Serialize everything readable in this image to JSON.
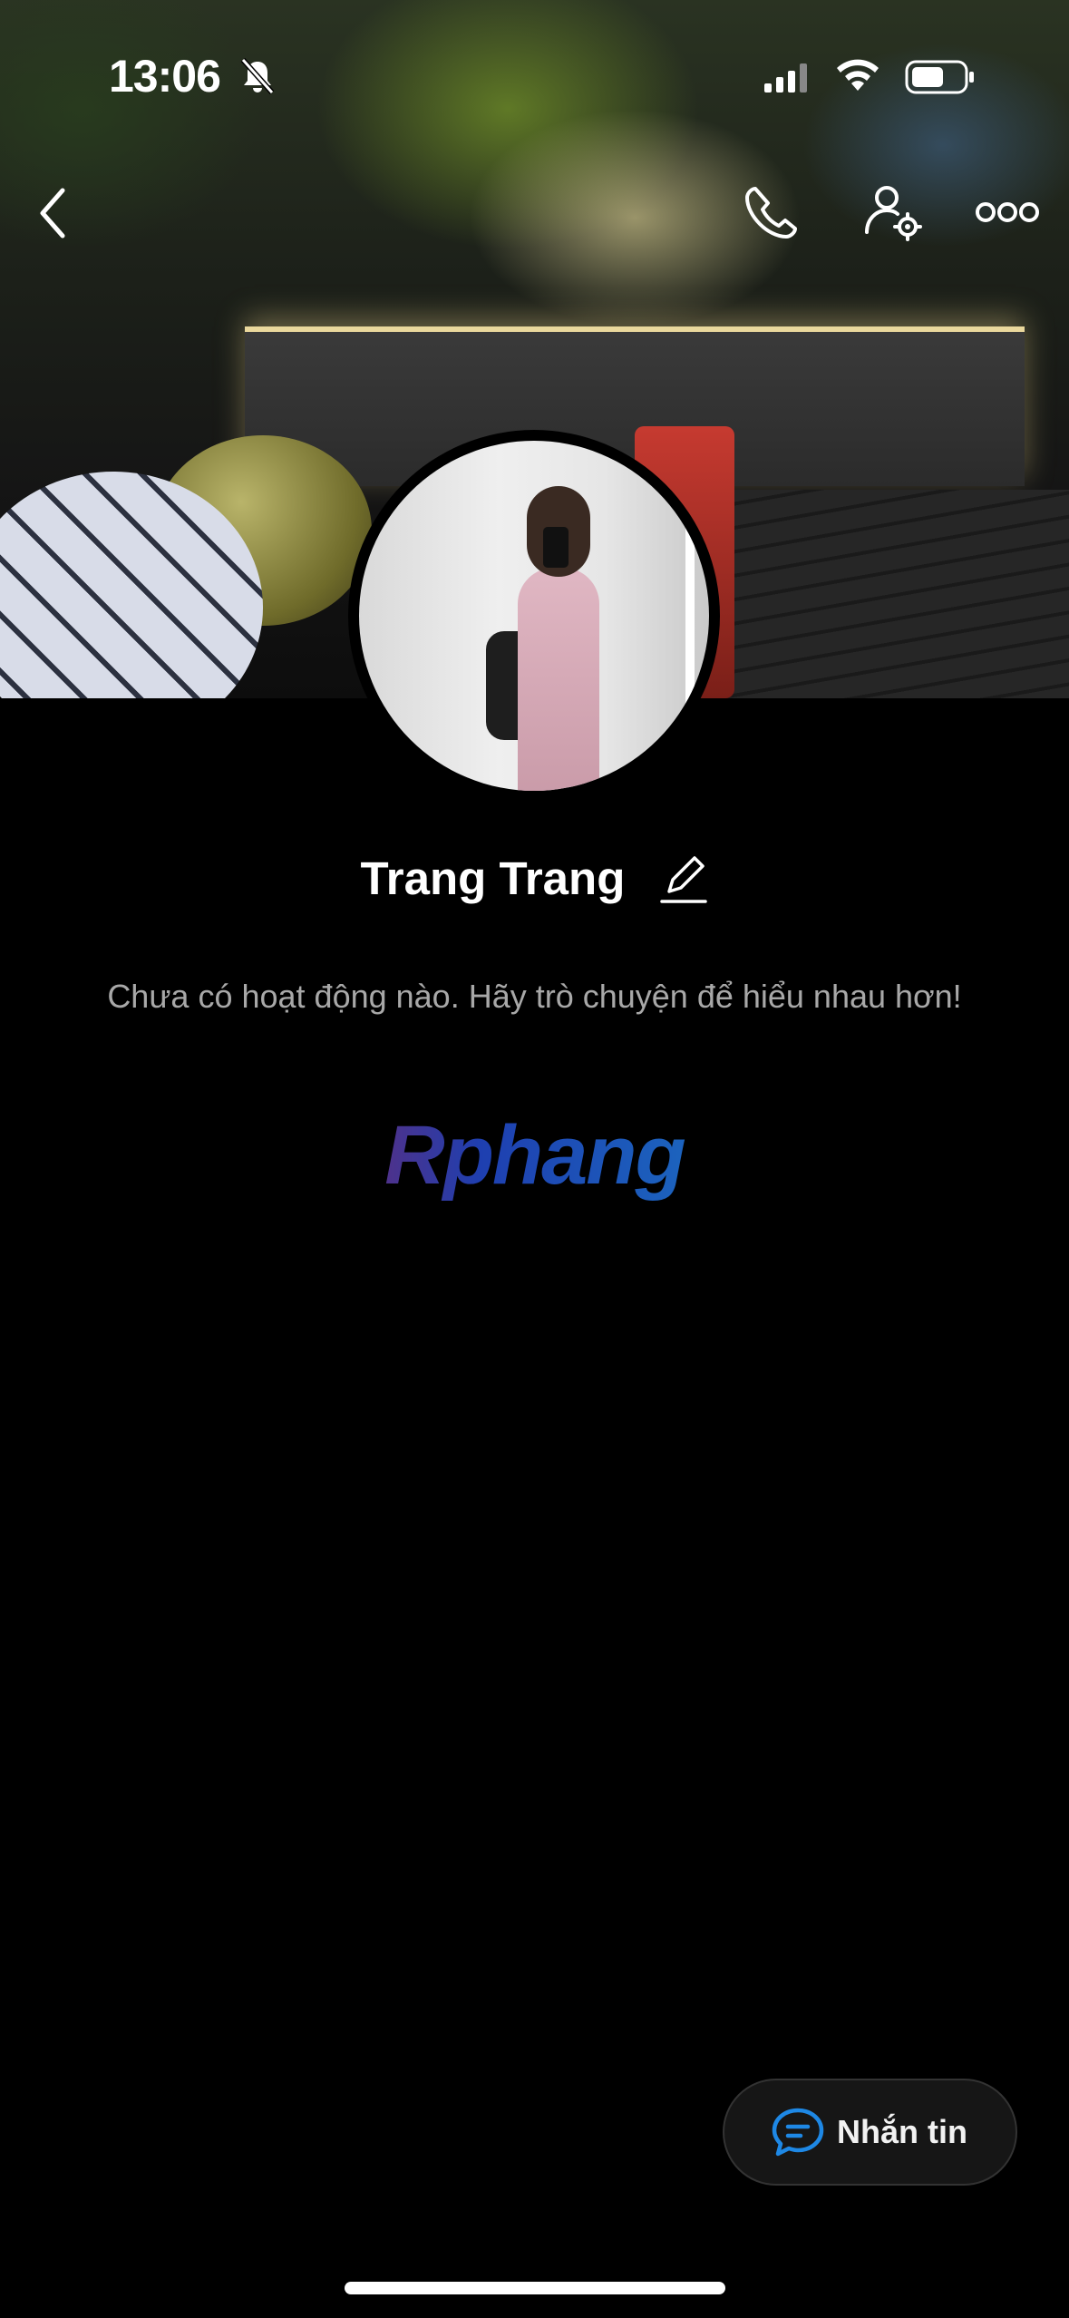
{
  "status_bar": {
    "time": "13:06",
    "bell_icon": "bell-slash-icon",
    "signal_icon": "cellular-signal-icon",
    "wifi_icon": "wifi-icon",
    "battery_icon": "battery-icon"
  },
  "nav": {
    "back_icon": "chevron-left-icon",
    "call_icon": "phone-icon",
    "settings_icon": "user-settings-icon",
    "more_icon": "more-dots-icon"
  },
  "profile": {
    "name": "Trang Trang",
    "edit_icon": "pencil-icon",
    "activity_empty": "Chưa có hoạt động nào. Hãy trò chuyện để hiểu nhau hơn!",
    "brand": "Rphang"
  },
  "message_button": {
    "label": "Nhắn tin",
    "icon": "chat-bubble-icon",
    "accent": "#1e88e5"
  }
}
